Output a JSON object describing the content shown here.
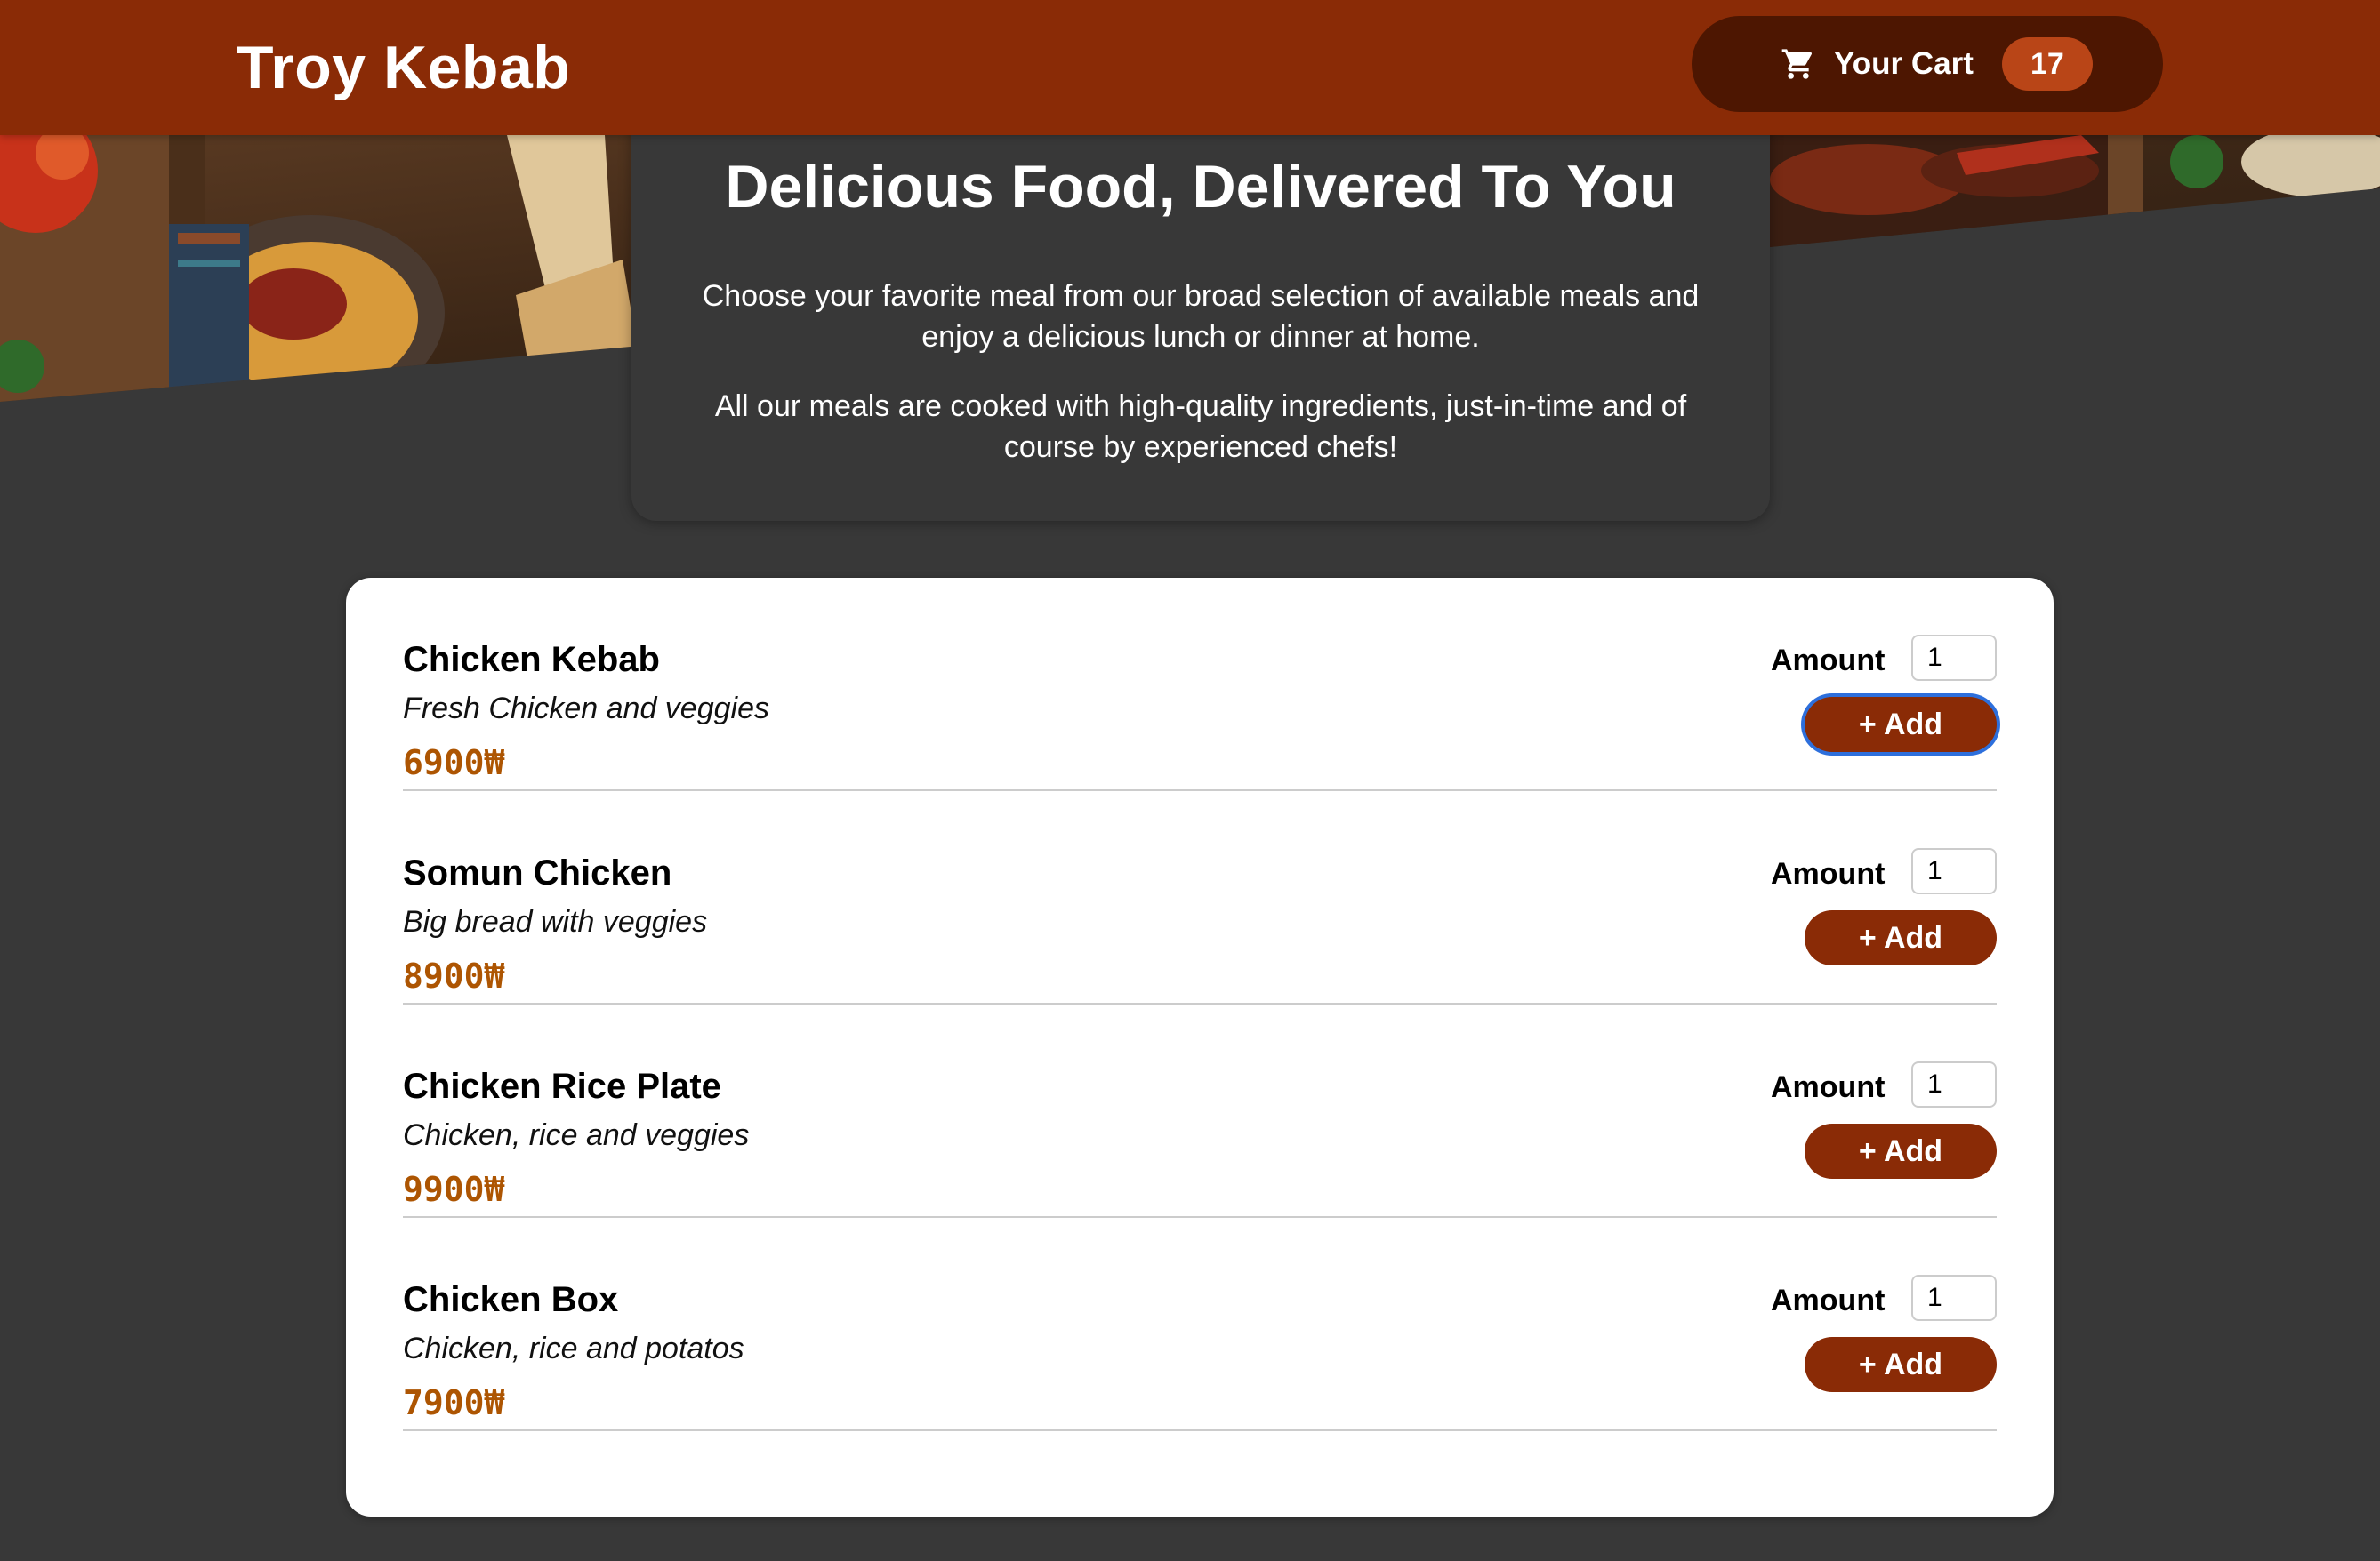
{
  "header": {
    "brand": "Troy Kebab",
    "cart_label": "Your Cart",
    "cart_count": "17",
    "cart_icon": "shopping-cart-icon"
  },
  "summary": {
    "title": "Delicious Food, Delivered To You",
    "paragraph1": "Choose your favorite meal from our broad selection of available meals and enjoy a delicious lunch or dinner at home.",
    "paragraph2": "All our meals are cooked with high-quality ingredients, just-in-time and of course by experienced chefs!"
  },
  "meals": [
    {
      "name": "Chicken Kebab",
      "description": "Fresh Chicken and veggies",
      "price": "6900₩",
      "amount_label": "Amount",
      "amount_value": "1",
      "add_label": "+ Add"
    },
    {
      "name": "Somun Chicken",
      "description": "Big bread with veggies",
      "price": "8900₩",
      "amount_label": "Amount",
      "amount_value": "1",
      "add_label": "+ Add"
    },
    {
      "name": "Chicken Rice Plate",
      "description": "Chicken, rice and veggies",
      "price": "9900₩",
      "amount_label": "Amount",
      "amount_value": "1",
      "add_label": "+ Add"
    },
    {
      "name": "Chicken Box",
      "description": "Chicken, rice and potatos",
      "price": "7900₩",
      "amount_label": "Amount",
      "amount_value": "1",
      "add_label": "+ Add"
    }
  ],
  "colors": {
    "header_bg": "#8a2b06",
    "cart_bg": "#4d1601",
    "badge_bg": "#b94517",
    "page_bg": "#383838",
    "price": "#ad5502",
    "button_bg": "#8a2b06",
    "focus_ring": "#2d6fdc"
  }
}
